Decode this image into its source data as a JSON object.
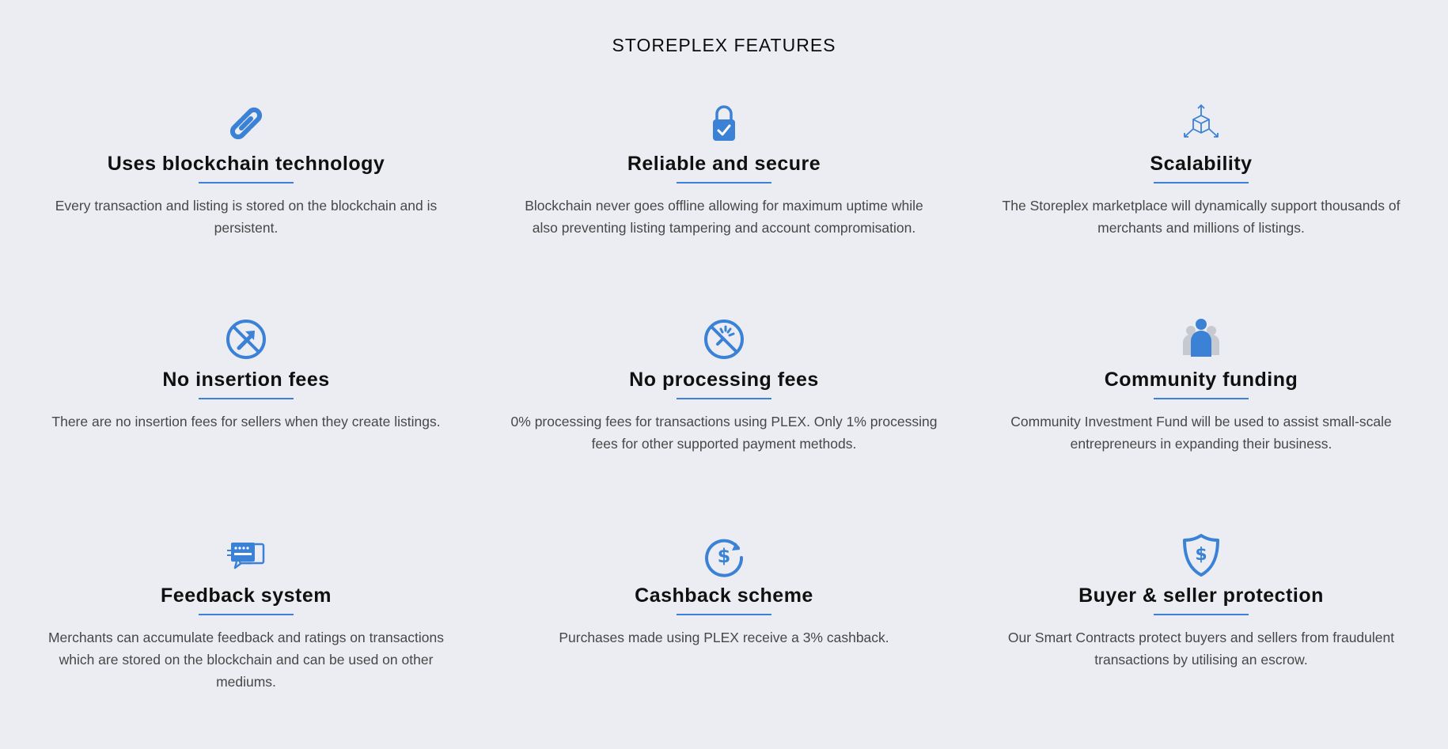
{
  "section": {
    "title": "STOREPLEX FEATURES"
  },
  "colors": {
    "accent": "#3b82d6",
    "background": "#ecedf3",
    "muted_icon": "#c7c9d0"
  },
  "features": [
    {
      "icon": "chain-link-icon",
      "title": "Uses blockchain technology",
      "description": "Every transaction and listing is stored on the blockchain and is persistent."
    },
    {
      "icon": "padlock-check-icon",
      "title": "Reliable and secure",
      "description": "Blockchain never goes offline allowing for maximum uptime while also preventing listing tampering and account compromisation."
    },
    {
      "icon": "scalable-cube-icon",
      "title": "Scalability",
      "description": "The Storeplex marketplace will dynamically support thousands of merchants and millions of listings."
    },
    {
      "icon": "no-insertion-icon",
      "title": "No insertion fees",
      "description": "There are no insertion fees for sellers when they create listings."
    },
    {
      "icon": "no-processing-icon",
      "title": "No processing fees",
      "description": "0% processing fees for transactions using PLEX. Only 1% processing fees for other supported payment methods."
    },
    {
      "icon": "community-people-icon",
      "title": "Community funding",
      "description": "Community Investment Fund will be used to assist small-scale entrepreneurs in expanding their business."
    },
    {
      "icon": "feedback-cards-icon",
      "title": "Feedback system",
      "description": "Merchants can accumulate feedback and ratings on transactions which are stored on the blockchain and can be used on other mediums."
    },
    {
      "icon": "cashback-dollar-icon",
      "title": "Cashback scheme",
      "description": "Purchases made using PLEX receive a 3% cashback."
    },
    {
      "icon": "shield-dollar-icon",
      "title": "Buyer & seller protection",
      "description": "Our Smart Contracts protect buyers and sellers from fraudulent transactions by utilising an escrow."
    }
  ]
}
